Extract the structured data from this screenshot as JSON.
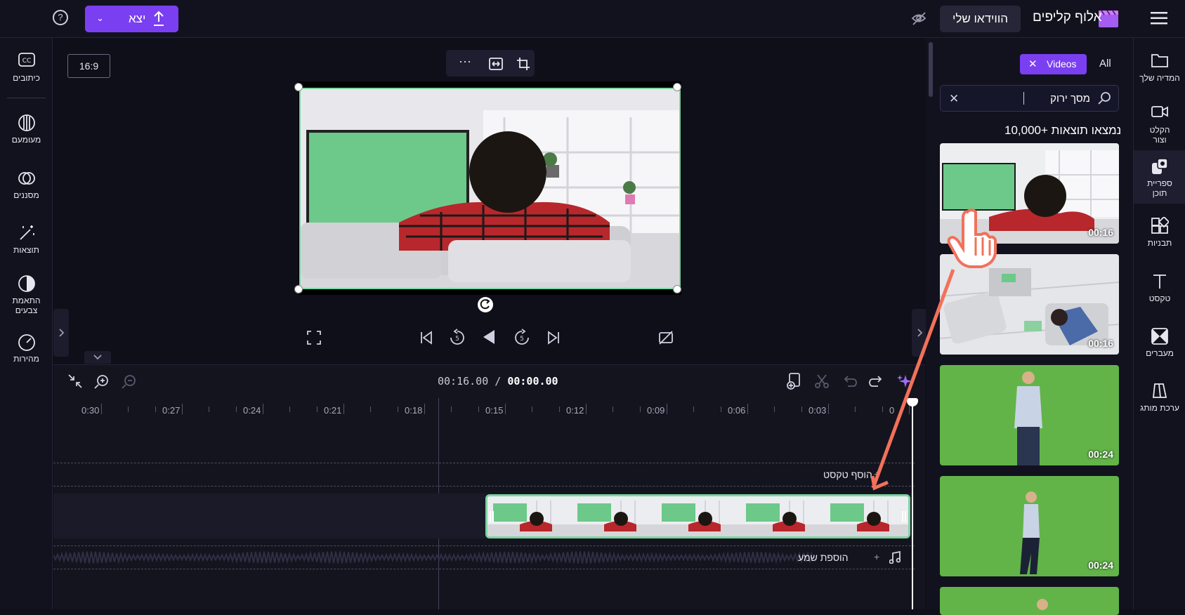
{
  "topbar": {
    "export_label": "יצא",
    "my_video_label": "הווידאו שלי",
    "brand_name": "אלוף קליפים"
  },
  "left_tools": [
    {
      "label": "כיתובים",
      "icon": "captions-icon"
    },
    {
      "label": "מעומעם",
      "icon": "fade-icon"
    },
    {
      "label": "מסננים",
      "icon": "filters-icon"
    },
    {
      "label": "תוצאות",
      "icon": "effects-wand-icon"
    },
    {
      "label": "התאמת צבעים",
      "icon": "color-adjust-icon"
    },
    {
      "label": "מהירות",
      "icon": "speed-gauge-icon"
    }
  ],
  "right_nav": [
    {
      "label": "המדיה שלך",
      "icon": "folder-icon"
    },
    {
      "label": "הקלט וצור",
      "icon": "record-camera-icon"
    },
    {
      "label": "ספריית תוכן",
      "icon": "content-library-icon"
    },
    {
      "label": "תבניות",
      "icon": "templates-icon"
    },
    {
      "label": "טקסט",
      "icon": "text-icon"
    },
    {
      "label": "מעברים",
      "icon": "transitions-icon"
    },
    {
      "label": "ערכת מותג",
      "icon": "brand-kit-icon"
    }
  ],
  "library": {
    "filter_all": "All",
    "filter_videos": "Videos",
    "search_value": "מסך ירוק",
    "results_text": "10,000+ נמצאו תוצאות",
    "items": [
      {
        "duration": "00:16",
        "kind": "greenscreen-tv-couch"
      },
      {
        "duration": "00:16",
        "kind": "livingroom-topview"
      },
      {
        "duration": "00:24",
        "kind": "greenscreen-man-back"
      },
      {
        "duration": "00:24",
        "kind": "greenscreen-man-side"
      }
    ]
  },
  "preview": {
    "aspect_ratio": "16:9"
  },
  "timeline": {
    "current_time": "00:00.00",
    "total_time": "00:16.00",
    "ticks": [
      "0",
      "0:03",
      "0:06",
      "0:09",
      "0:12",
      "0:15",
      "0:18",
      "0:21",
      "0:24",
      "0:27",
      "0:30"
    ],
    "add_text_label": "הוסף טקסט",
    "add_audio_label": "הוספת שמע"
  },
  "colors": {
    "accent": "#7b3ff2",
    "clip_border": "#7bd6a2",
    "background": "#0f0f1a",
    "annotation_arrow": "#f2715a"
  }
}
